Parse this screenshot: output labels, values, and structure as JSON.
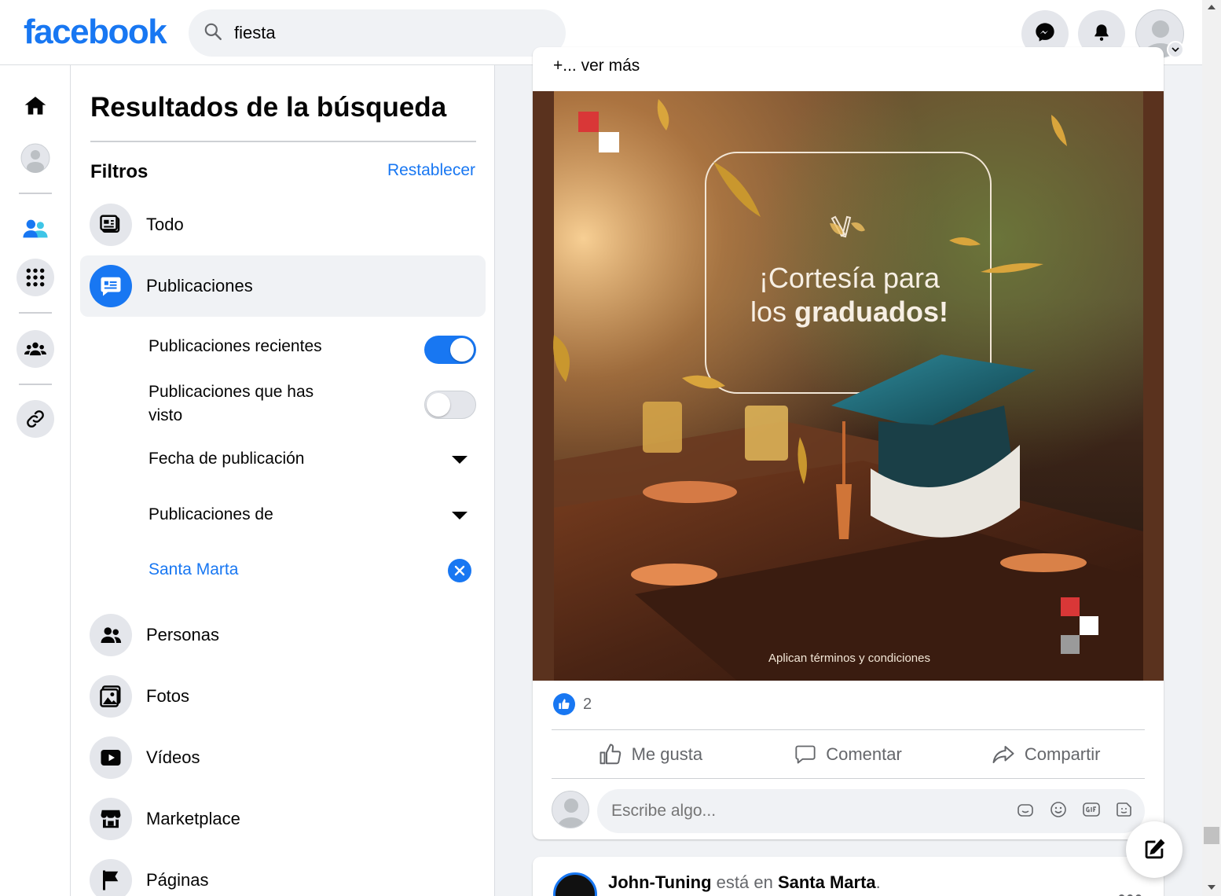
{
  "brand": {
    "logo_text": "facebook",
    "accent": "#1877f2"
  },
  "search": {
    "value": "fiesta",
    "icon": "search-icon"
  },
  "topbar": {
    "icons": [
      "messenger-icon",
      "bell-icon",
      "profile-avatar"
    ]
  },
  "rail": {
    "items": [
      "home-icon",
      "profile-icon",
      "friends-icon",
      "menu-grid-icon",
      "groups-icon",
      "link-icon"
    ]
  },
  "filters": {
    "title": "Resultados de la búsqueda",
    "filtros_label": "Filtros",
    "reset_label": "Restablecer",
    "categories": [
      {
        "label": "Todo",
        "icon": "feed-icon",
        "active": false
      },
      {
        "label": "Publicaciones",
        "icon": "posts-icon",
        "active": true
      },
      {
        "label": "Personas",
        "icon": "people-icon",
        "active": false
      },
      {
        "label": "Fotos",
        "icon": "photos-icon",
        "active": false
      },
      {
        "label": "Vídeos",
        "icon": "video-icon",
        "active": false
      },
      {
        "label": "Marketplace",
        "icon": "store-icon",
        "active": false
      },
      {
        "label": "Páginas",
        "icon": "flag-icon",
        "active": false
      }
    ],
    "sub_options": {
      "recent_label": "Publicaciones recientes",
      "recent_on": true,
      "seen_label_line1": "Publicaciones que has",
      "seen_label_line2": "visto",
      "seen_on": false,
      "date_label": "Fecha de publicación",
      "from_label": "Publicaciones de",
      "location_label": "Santa Marta"
    }
  },
  "post": {
    "see_more": "+... ver más",
    "image_title_line1": "¡Cortesía para",
    "image_title_line2_light": "los ",
    "image_title_line2_bold": "graduados!",
    "image_footer": "Aplican términos y condiciones",
    "like_count": "2",
    "actions": {
      "like": "Me gusta",
      "comment": "Comentar",
      "share": "Compartir"
    },
    "comment_placeholder": "Escribe algo..."
  },
  "next_post": {
    "author": "John-Tuning",
    "middle": " está en ",
    "place": "Santa Marta",
    "tail": "."
  }
}
